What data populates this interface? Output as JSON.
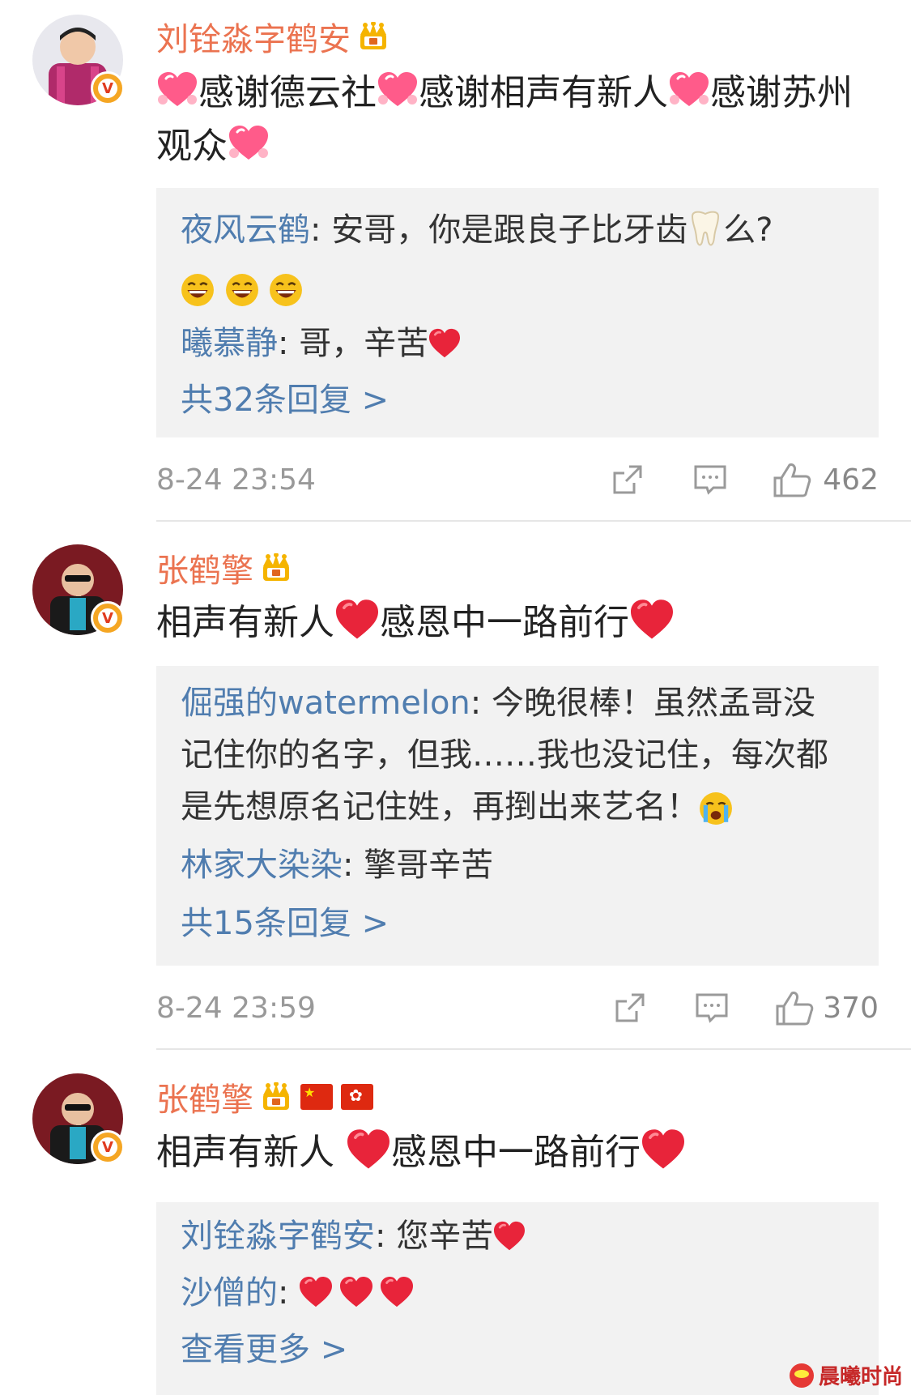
{
  "comments": [
    {
      "username": "刘铨淼字鹤安",
      "text_parts": [
        "感谢德云社",
        "感谢相声有新人",
        "感谢苏州观众"
      ],
      "replies": [
        {
          "name": "夜风云鹤",
          "text": ": 安哥，你是跟良子比牙齿",
          "after": "么?"
        },
        {
          "name": "曦慕静",
          "text": ": 哥，辛苦"
        }
      ],
      "more": "共32条回复 >",
      "time": "8-24 23:54",
      "likes": "462"
    },
    {
      "username": "张鹤擎",
      "text_a": "相声有新人",
      "text_b": "感恩中一路前行",
      "replies": [
        {
          "name": "倔强的watermelon",
          "text_l1": ": 今晚很棒！虽然孟哥没",
          "text_l2": "记住你的名字，但我……我也没记住，每次都",
          "text_l3": "是先想原名记住姓，再捯出来艺名！"
        },
        {
          "name": "林家大染染",
          "text": ": 擎哥辛苦"
        }
      ],
      "more": "共15条回复 >",
      "time": "8-24 23:59",
      "likes": "370"
    },
    {
      "username": "张鹤擎",
      "text_a": "相声有新人 ",
      "text_b": "感恩中一路前行",
      "replies": [
        {
          "name": "刘铨淼字鹤安",
          "text": ": 您辛苦"
        },
        {
          "name": "沙僧的",
          "text": ": "
        }
      ],
      "more": "查看更多 >"
    }
  ],
  "watermark": "晨曦时尚",
  "icons": [
    "verified-v-icon",
    "crown-icon",
    "share-icon",
    "comment-icon",
    "like-icon",
    "heart-icon",
    "laugh-icon",
    "tooth-icon",
    "cry-icon",
    "china-flag-icon",
    "hk-flag-icon"
  ],
  "colors": {
    "username": "#eb7350",
    "reply_name": "#507daf",
    "reply_bg": "#f2f2f2",
    "meta": "#999999",
    "heart": "#e8343a"
  }
}
